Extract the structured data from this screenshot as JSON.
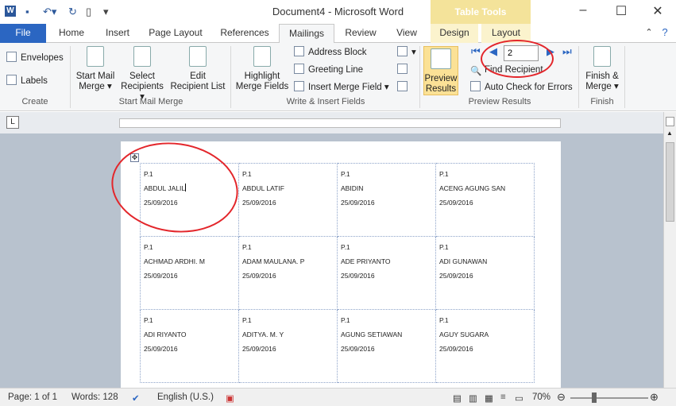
{
  "window": {
    "title": "Document4 - Microsoft Word",
    "context_tab_group": "Table Tools",
    "buttons": [
      "minimize-icon",
      "maximize-icon",
      "close-icon"
    ]
  },
  "tabs": [
    {
      "label": "File"
    },
    {
      "label": "Home"
    },
    {
      "label": "Insert"
    },
    {
      "label": "Page Layout"
    },
    {
      "label": "References"
    },
    {
      "label": "Mailings"
    },
    {
      "label": "Review"
    },
    {
      "label": "View"
    },
    {
      "label": "Design"
    },
    {
      "label": "Layout"
    }
  ],
  "ribbon": {
    "create": {
      "label": "Create",
      "envelopes": "Envelopes",
      "labels": "Labels"
    },
    "start_mail_merge": {
      "label": "Start Mail Merge",
      "start": [
        "Start Mail",
        "Merge ▾"
      ],
      "select": [
        "Select",
        "Recipients ▾"
      ],
      "edit": [
        "Edit",
        "Recipient List"
      ]
    },
    "write_insert": {
      "label": "Write & Insert Fields",
      "highlight": [
        "Highlight",
        "Merge Fields"
      ],
      "address_block": "Address Block",
      "greeting_line": "Greeting Line",
      "insert_merge_field": "Insert Merge Field ▾"
    },
    "preview": {
      "label": "Preview Results",
      "preview_results": [
        "Preview",
        "Results"
      ],
      "recipient_value": "2",
      "find_recipient": "Find Recipient",
      "auto_check": "Auto Check for Errors"
    },
    "finish": {
      "label": "Finish",
      "finish_merge": [
        "Finish &",
        "Merge ▾"
      ]
    }
  },
  "labels_table": [
    [
      {
        "line1": "P.1",
        "name": "ABDUL JALIL",
        "date": "25/09/2016"
      },
      {
        "line1": "P.1",
        "name": "ABDUL LATIF",
        "date": "25/09/2016"
      },
      {
        "line1": "P.1",
        "name": "ABIDIN",
        "date": "25/09/2016"
      },
      {
        "line1": "P.1",
        "name": "ACENG AGUNG SAN",
        "date": "25/09/2016"
      }
    ],
    [
      {
        "line1": "P.1",
        "name": "ACHMAD ARDHI. M",
        "date": "25/09/2016"
      },
      {
        "line1": "P.1",
        "name": "ADAM MAULANA. P",
        "date": "25/09/2016"
      },
      {
        "line1": "P.1",
        "name": "ADE PRIYANTO",
        "date": "25/09/2016"
      },
      {
        "line1": "P.1",
        "name": "ADI GUNAWAN",
        "date": "25/09/2016"
      }
    ],
    [
      {
        "line1": "P.1",
        "name": "ADI RIYANTO",
        "date": "25/09/2016"
      },
      {
        "line1": "P.1",
        "name": "ADITYA. M. Y",
        "date": "25/09/2016"
      },
      {
        "line1": "P.1",
        "name": "AGUNG SETIAWAN",
        "date": "25/09/2016"
      },
      {
        "line1": "P.1",
        "name": "AGUY SUGARA",
        "date": "25/09/2016"
      }
    ]
  ],
  "status": {
    "page": "Page: 1 of 1",
    "words": "Words: 128",
    "language": "English (U.S.)",
    "zoom": "70%"
  },
  "colors": {
    "file_tab": "#2b66c2",
    "context_tab": "#f4e39a",
    "annotation": "#e3262b"
  }
}
